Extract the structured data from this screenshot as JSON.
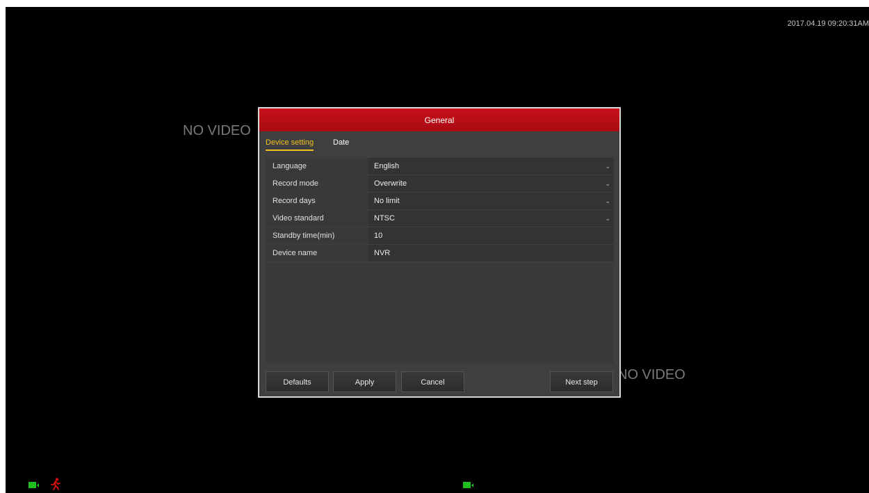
{
  "timestamp": "2017.04.19 09:20:31AM",
  "no_video_label_1": "NO VIDEO",
  "no_video_label_2": "NO VIDEO",
  "dialog": {
    "title": "General",
    "tabs": [
      {
        "label": "Device setting",
        "active": true
      },
      {
        "label": "Date",
        "active": false
      }
    ],
    "fields": [
      {
        "label": "Language",
        "value": "English",
        "type": "dropdown"
      },
      {
        "label": "Record mode",
        "value": "Overwrite",
        "type": "dropdown"
      },
      {
        "label": "Record days",
        "value": "No limit",
        "type": "dropdown"
      },
      {
        "label": "Video standard",
        "value": "NTSC",
        "type": "dropdown"
      },
      {
        "label": "Standby time(min)",
        "value": "10",
        "type": "input"
      },
      {
        "label": "Device name",
        "value": "NVR",
        "type": "input"
      }
    ],
    "buttons": {
      "defaults": "Defaults",
      "apply": "Apply",
      "cancel": "Cancel",
      "next": "Next step"
    }
  },
  "colors": {
    "title_bar": "#b50e16",
    "active_tab": "#f0c020",
    "camera_status": "#1fbf1f",
    "motion_alert": "#e01010"
  },
  "icons": {
    "camera_status": "camera-icon",
    "motion_alert": "running-person-icon",
    "dropdown": "chevron-down-icon"
  }
}
